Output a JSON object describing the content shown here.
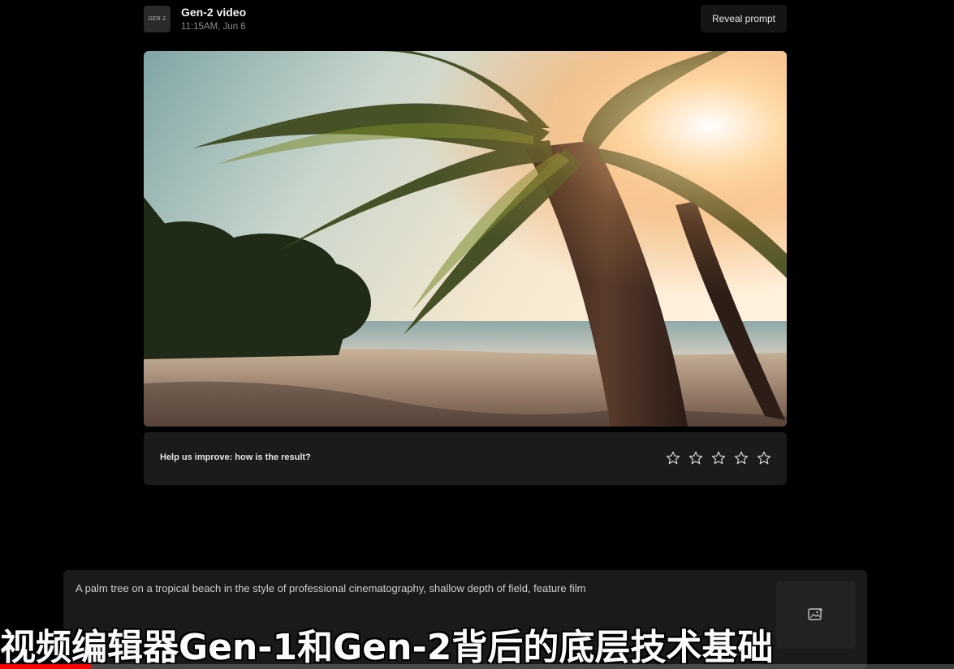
{
  "header": {
    "logo_text": "GEN-2",
    "title": "Gen-2 video",
    "timestamp": "11:15AM, Jun 6",
    "reveal_button": "Reveal prompt"
  },
  "media": {
    "description_icon": "video-thumbnail"
  },
  "feedback": {
    "question": "Help us improve: how is the result?",
    "rating_max": 5,
    "rating_value": 0
  },
  "prompt": {
    "text": "A palm tree on a tropical beach in the style of professional cinematography, shallow depth of field, feature film",
    "image_button_icon": "image-add-icon"
  },
  "caption": {
    "text": "视频编辑器Gen-1和Gen-2背后的底层技术基础"
  },
  "playback": {
    "progress_fraction": 0.095
  },
  "colors": {
    "background": "#000000",
    "panel": "#1b1b1d",
    "progress": "#ff0000"
  }
}
